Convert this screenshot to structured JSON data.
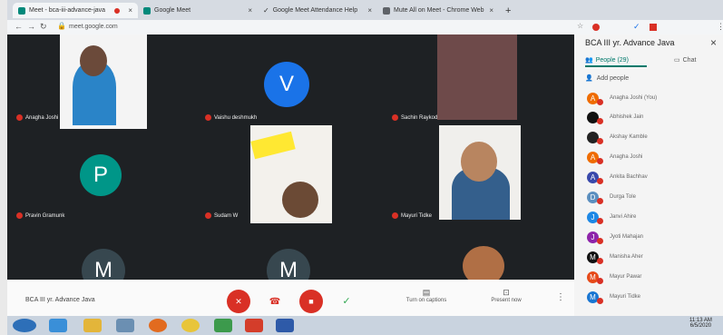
{
  "tabs": [
    {
      "label": "Meet - bca-iii-advance-java"
    },
    {
      "label": "Google Meet"
    },
    {
      "label": "Google Meet Attendance Help"
    },
    {
      "label": "Mute All on Meet - Chrome Web"
    }
  ],
  "new_tab_label": "+",
  "address": {
    "url": "meet.google.com"
  },
  "participants": {
    "anagha": "Anagha Joshi",
    "vaishu": "Vaishu deshmukh",
    "sachin": "Sachin Raykod",
    "pravin": "Pravin Gramunk",
    "sudam": "Sudam W",
    "mayuri": "Mayuri Tidke"
  },
  "avatars": {
    "v": "V",
    "p": "P",
    "m1": "M",
    "m2": "M"
  },
  "meeting_name": "BCA III yr. Advance Java",
  "controls": {
    "captions_label": "Turn on captions",
    "present_label": "Present now",
    "more": "⋮"
  },
  "panel": {
    "title": "BCA III yr. Advance Java",
    "close": "×",
    "people_tab": "People (29)",
    "chat_tab": "Chat",
    "add_people": "Add people",
    "people": [
      {
        "initial": "A",
        "name": "Anagha Joshi (You)",
        "color": "#ef6c00"
      },
      {
        "initial": "",
        "name": "Abhishek Jain",
        "color": "#111111"
      },
      {
        "initial": "",
        "name": "Akshay Kamble",
        "color": "#222222"
      },
      {
        "initial": "A",
        "name": "Anagha Joshi",
        "color": "#ef6c00"
      },
      {
        "initial": "A",
        "name": "Ankita Bachhav",
        "color": "#3949ab"
      },
      {
        "initial": "D",
        "name": "Durga Tole",
        "color": "#5c8fbf"
      },
      {
        "initial": "J",
        "name": "Janvi Ahire",
        "color": "#1e88e5"
      },
      {
        "initial": "J",
        "name": "Jyoti Mahajan",
        "color": "#8e24aa"
      },
      {
        "initial": "M",
        "name": "Manisha Aher",
        "color": "#111111"
      },
      {
        "initial": "M",
        "name": "Mayur Pawar",
        "color": "#e64a19"
      },
      {
        "initial": "M",
        "name": "Mayuri Tidke",
        "color": "#1976d2"
      }
    ]
  },
  "taskbar": {
    "time": "11:13 AM",
    "date": "6/5/2020"
  }
}
